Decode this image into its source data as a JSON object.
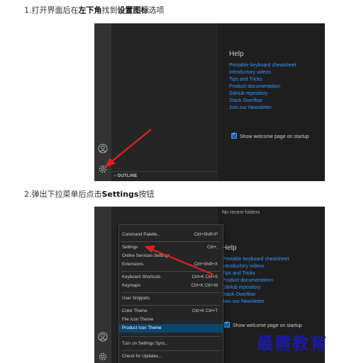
{
  "step1": {
    "prefix": "1.打开界面后在",
    "bold1": "左下角",
    "mid": "找到",
    "bold2": "设置图标",
    "suffix": "选项"
  },
  "step2": {
    "prefix": "2.弹出下拉菜单后点击",
    "bold": "Settings",
    "suffix": "按钮"
  },
  "shot1": {
    "outline_label": "OUTLINE",
    "welcome": {
      "heading": "Help",
      "links": [
        "Printable keyboard cheatsheet",
        "Introductory videos",
        "Tips and Tricks",
        "Product documentation",
        "GitHub repository",
        "Stack Overflow",
        "Join our Newsletter"
      ]
    },
    "checkbox_label": "Show welcome page on startup"
  },
  "shot2": {
    "recent": "No recent folders",
    "menu": [
      {
        "label": "Command Palette...",
        "shortcut": "Ctrl+Shift+P"
      },
      {
        "label": "Settings",
        "shortcut": "Ctrl+,"
      },
      {
        "label": "Online Services Settings",
        "shortcut": ""
      },
      {
        "label": "Extensions",
        "shortcut": "Ctrl+Shift+X"
      },
      {
        "label": "Keyboard Shortcuts",
        "shortcut": "Ctrl+K Ctrl+S"
      },
      {
        "label": "Keymaps",
        "shortcut": "Ctrl+K Ctrl+M"
      },
      {
        "label": "User Snippets",
        "shortcut": ""
      },
      {
        "label": "Color Theme",
        "shortcut": "Ctrl+K Ctrl+T"
      },
      {
        "label": "File Icon Theme",
        "shortcut": ""
      },
      {
        "label": "Product Icon Theme",
        "shortcut": ""
      },
      {
        "label": "Turn on Settings Sync...",
        "shortcut": ""
      },
      {
        "label": "Check for Updates...",
        "shortcut": ""
      }
    ],
    "welcome": {
      "heading": "Help",
      "links": [
        "Printable keyboard cheatsheet",
        "Introductory videos",
        "Tips and Tricks",
        "Product documentation",
        "GitHub repository",
        "Stack Overflow",
        "Join our Newsletter"
      ]
    },
    "checkbox_label": "Show welcome page on startup"
  },
  "watermark": "最需教育",
  "colors": {
    "accent": "#3794ff",
    "arrow": "#e02020",
    "highlight": "#094771"
  }
}
